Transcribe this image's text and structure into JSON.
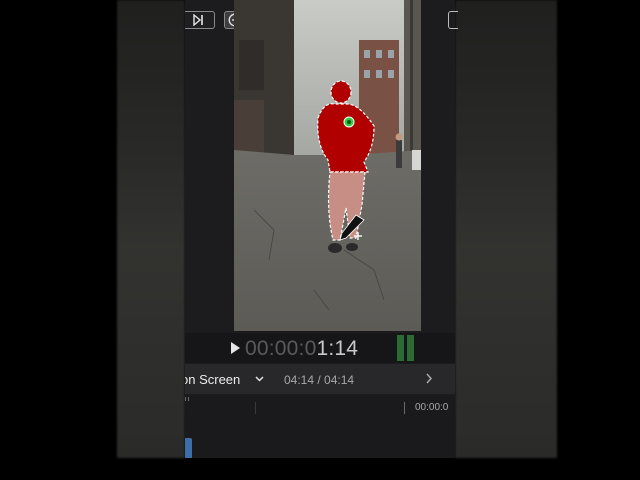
{
  "toolbar": {
    "skip_end_icon": "skip-to-end-icon",
    "add_icon": "plus-circle-icon",
    "subtract_icon": "minus-circle-icon",
    "clear_icon": "x-circle-icon",
    "prev_icon": "chevron-left-icon",
    "next_icon": "chevron-right-icon"
  },
  "viewer": {
    "selection_color": "#b00000",
    "marker_color": "#2ecc40"
  },
  "playback": {
    "timecode_dim": "00:00:0",
    "timecode_lit": "1:14",
    "play_icon": "play-icon"
  },
  "clip": {
    "name": "on Screen",
    "duration": "04:14 / 04:14"
  },
  "timeline": {
    "ruler_time": "00:00:0"
  }
}
